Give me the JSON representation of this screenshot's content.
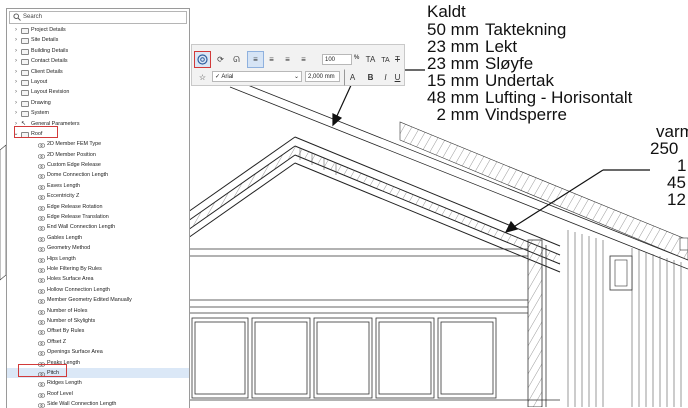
{
  "browser": {
    "search_placeholder": "Search",
    "top_items": [
      {
        "label": "Project Details"
      },
      {
        "label": "Site Details"
      },
      {
        "label": "Building Details"
      },
      {
        "label": "Contact Details"
      },
      {
        "label": "Client Details"
      },
      {
        "label": "Layout"
      },
      {
        "label": "Layout Revision"
      },
      {
        "label": "Drawing"
      },
      {
        "label": "System"
      },
      {
        "label": "General Parameters"
      },
      {
        "label": "Roof"
      }
    ],
    "roof_children": [
      "2D Member FEM Type",
      "2D Member Position",
      "Custom Edge Release",
      "Dome Connection Length",
      "Eaves Length",
      "Eccentricity Z",
      "Edge Release Rotation",
      "Edge Release Translation",
      "End Wall Connection Length",
      "Gables Length",
      "Geometry Method",
      "Hips Length",
      "Hole Filtering By Rules",
      "Holes Surface Area",
      "Hollow Connection Length",
      "Member Geometry Edited Manually",
      "Number of Holes",
      "Number of Skylights",
      "Offset By Rules",
      "Offset Z",
      "Openings Surface Area",
      "Peaks Length",
      "Pitch",
      "Ridges Length",
      "Roof Level",
      "Side Wall Connection Length"
    ],
    "selected_item": "Pitch"
  },
  "toolbar": {
    "size_value": "100",
    "percent_label": "%",
    "font_name": "Arial",
    "text_height": "2,000",
    "unit": "mm",
    "text_size_up": "TA",
    "text_size_down": "TA",
    "strike": "T",
    "bold": "B",
    "italic": "I",
    "underline": "U",
    "text_color_label": "A"
  },
  "label_block": {
    "title": "Kaldt",
    "layers": [
      {
        "qty": "50 mm",
        "name": "Taktekning"
      },
      {
        "qty": "23 mm",
        "name": "Lekt"
      },
      {
        "qty": "23 mm",
        "name": "Sløyfe"
      },
      {
        "qty": "15 mm",
        "name": "Undertak"
      },
      {
        "qty": "48 mm",
        "name": "Lufting - Horisontalt"
      },
      {
        "qty": "2 mm",
        "name": "Vindsperre"
      }
    ]
  },
  "right_block": {
    "title": "varm",
    "values": [
      "250",
      "1",
      "45",
      "12"
    ]
  }
}
